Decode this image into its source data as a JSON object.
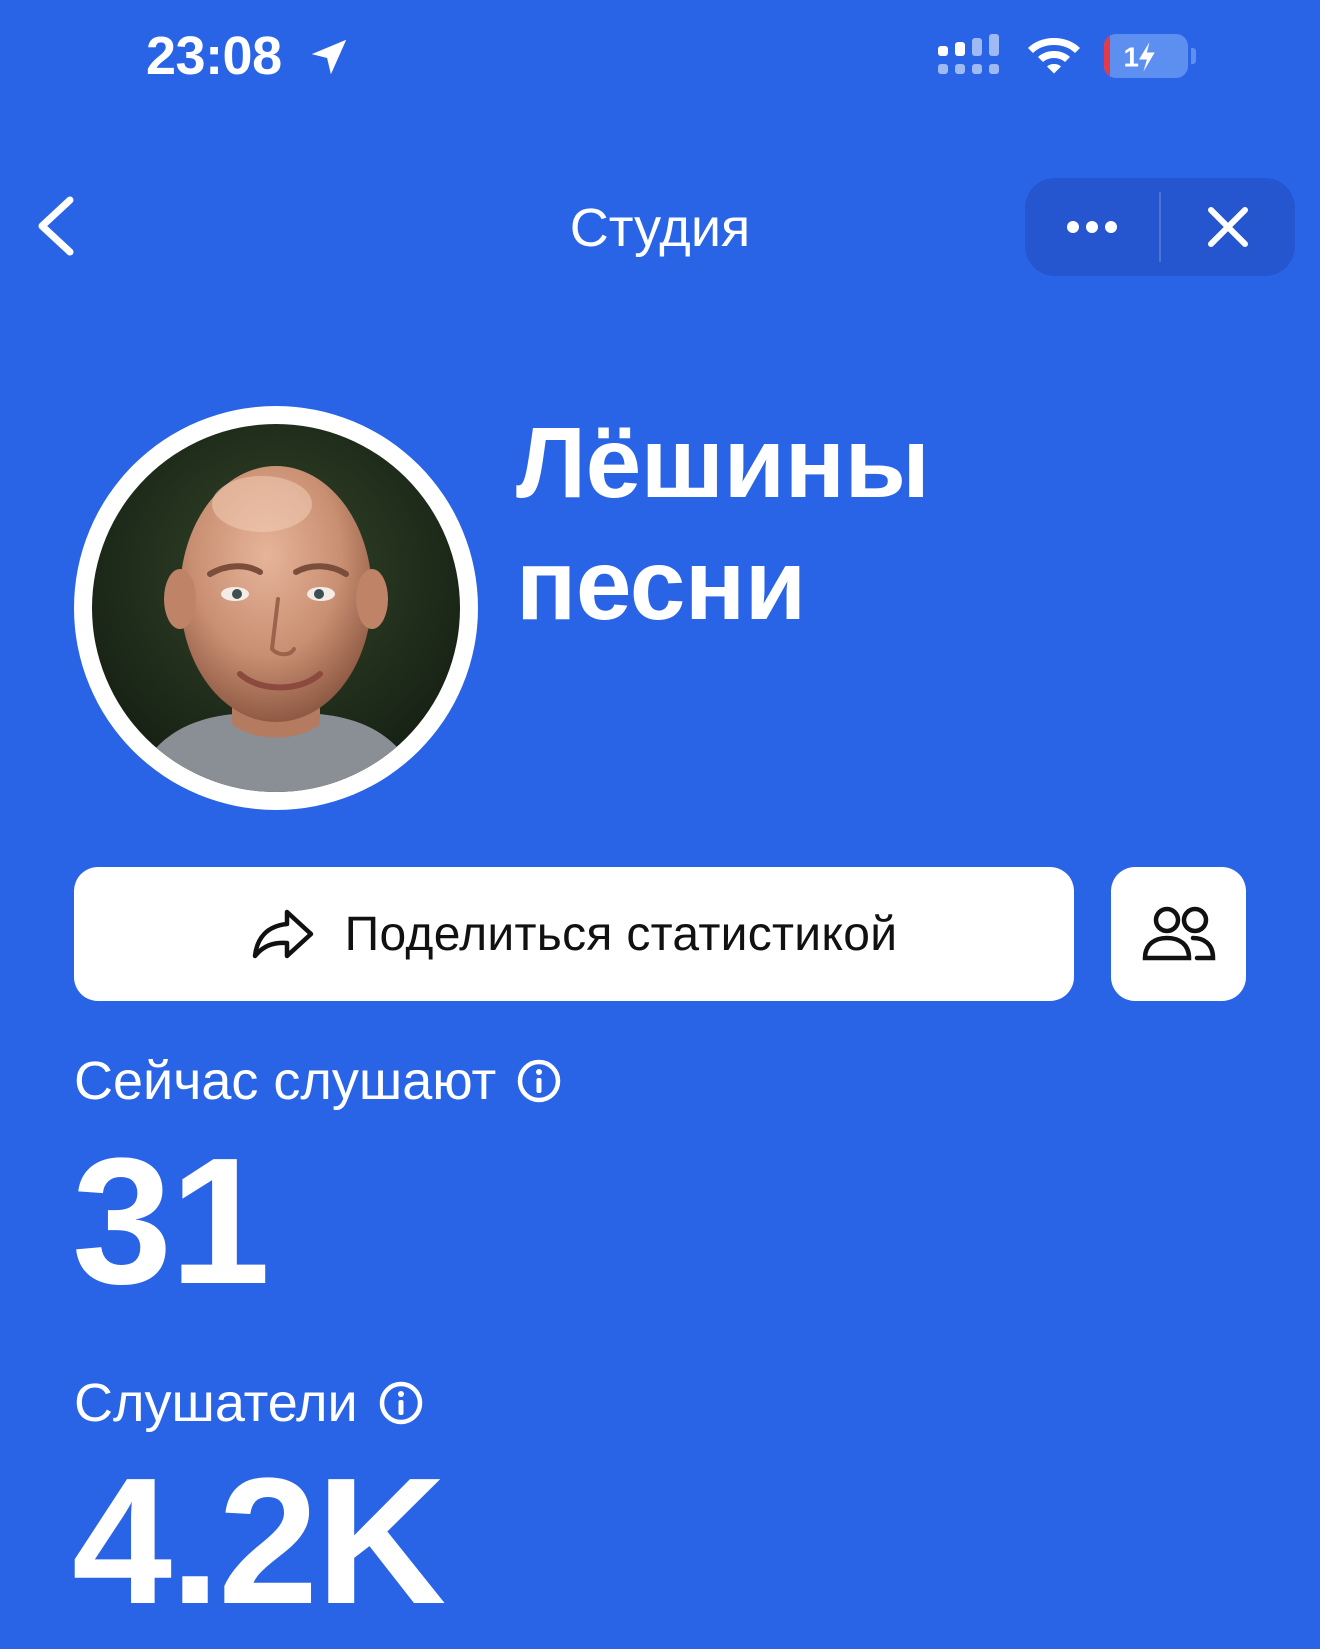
{
  "status_bar": {
    "time": "23:08",
    "battery_level": "14",
    "icons": [
      "location-arrow-icon",
      "cellular-signal-icon",
      "wifi-icon",
      "battery-charging-icon"
    ]
  },
  "nav": {
    "title": "Студия",
    "icons": [
      "chevron-left-icon",
      "more-dots-icon",
      "close-icon"
    ]
  },
  "profile": {
    "name": "Лёшины песни",
    "avatar": "avatar-photo"
  },
  "actions": {
    "share_label": "Поделиться статистикой",
    "share_icon": "share-arrow-icon",
    "people_icon": "people-icon"
  },
  "stats": {
    "now_listening_label": "Сейчас слушают",
    "now_listening_value": "31",
    "listeners_label": "Слушатели",
    "listeners_value": "4.2K",
    "info_icon": "info-circle-icon"
  },
  "colors": {
    "background": "#2a64e6",
    "capsule": "#2556cf",
    "button": "#ffffff",
    "battery_low": "#e6394a"
  }
}
